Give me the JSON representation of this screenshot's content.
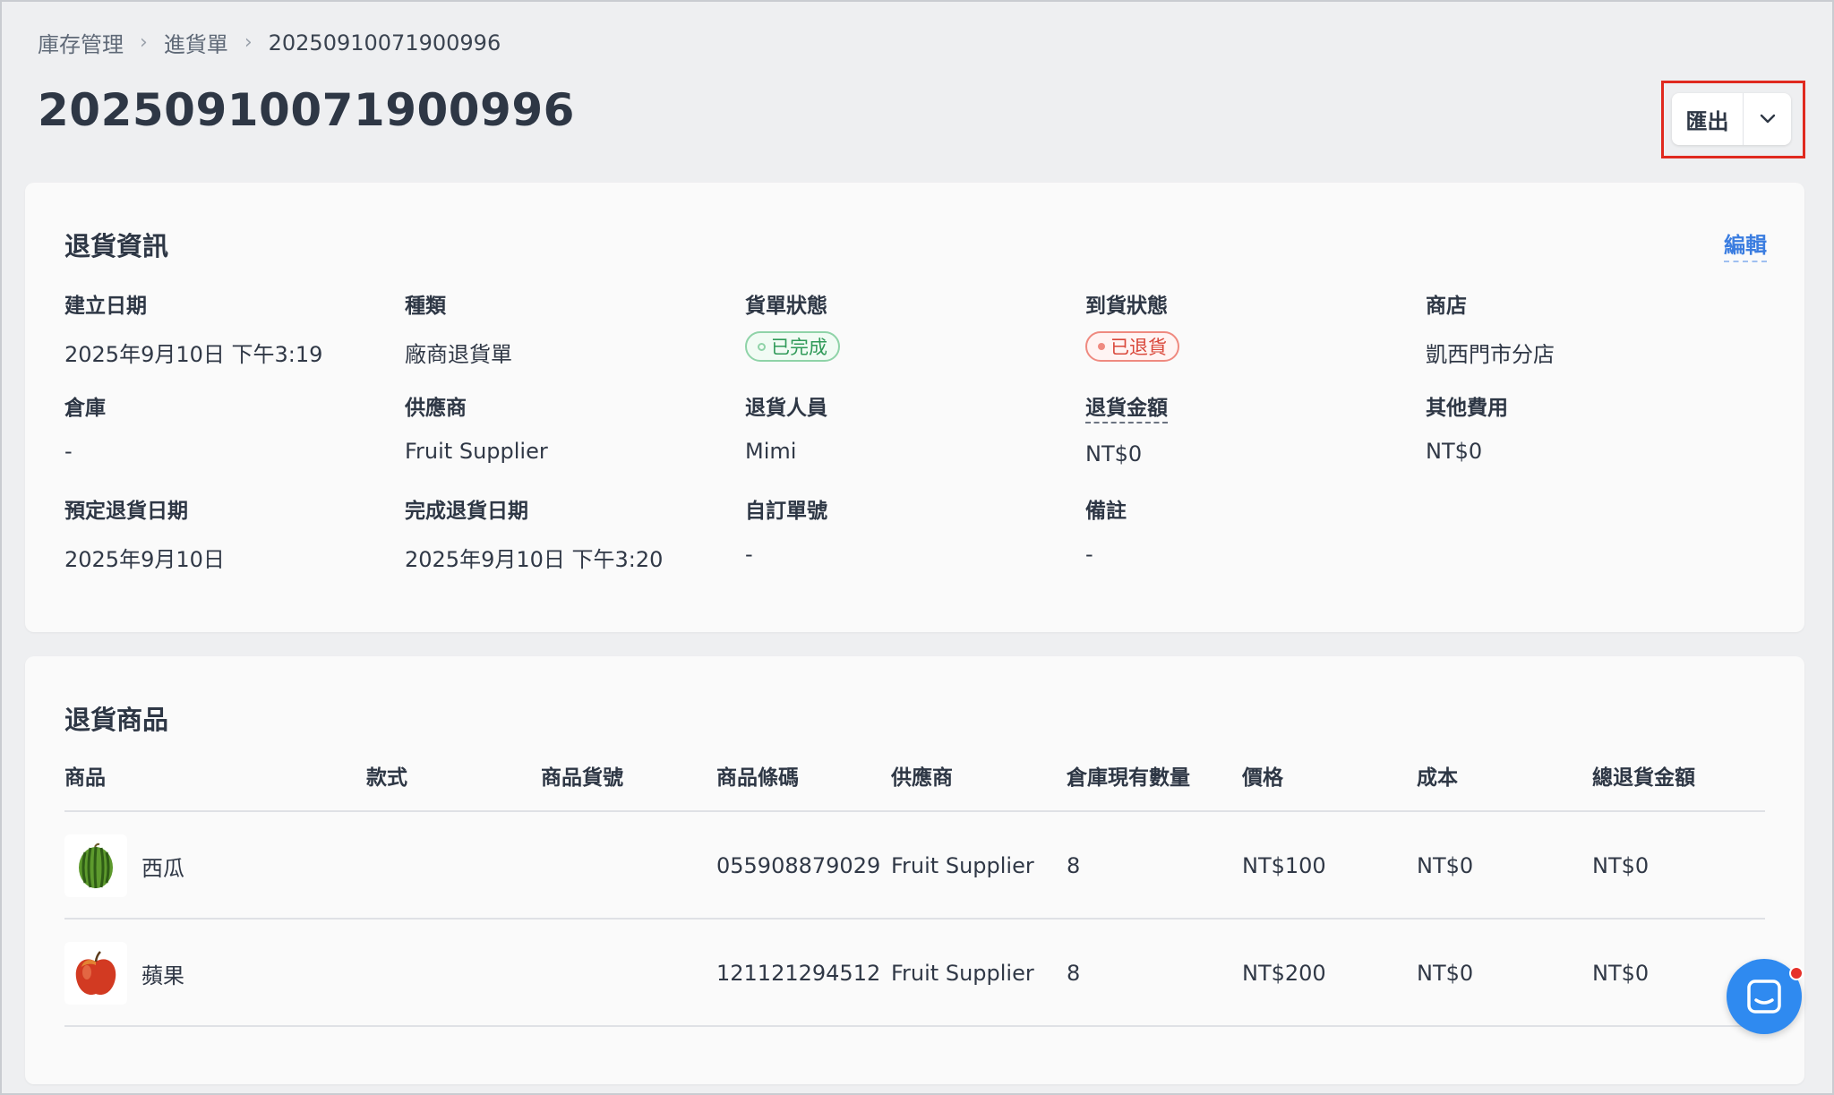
{
  "breadcrumb": {
    "items": [
      "庫存管理",
      "進貨單"
    ],
    "current": "20250910071900996"
  },
  "page_title": "20250910071900996",
  "export": {
    "label": "匯出"
  },
  "info_card": {
    "title": "退貨資訊",
    "edit_label": "編輯",
    "fields": {
      "created_date": {
        "label": "建立日期",
        "value": "2025年9月10日 下午3:19"
      },
      "type": {
        "label": "種類",
        "value": "廠商退貨單"
      },
      "order_status": {
        "label": "貨單狀態",
        "value": "已完成",
        "color": "#2f9a58"
      },
      "arrival_status": {
        "label": "到貨狀態",
        "value": "已退貨",
        "color": "#d9473a"
      },
      "store": {
        "label": "商店",
        "value": "凱西門市分店"
      },
      "warehouse": {
        "label": "倉庫",
        "value": "-"
      },
      "supplier": {
        "label": "供應商",
        "value": "Fruit Supplier"
      },
      "return_staff": {
        "label": "退貨人員",
        "value": "Mimi"
      },
      "return_amount": {
        "label": "退貨金額",
        "value": "NT$0"
      },
      "other_fees": {
        "label": "其他費用",
        "value": "NT$0"
      },
      "scheduled_return_date": {
        "label": "預定退貨日期",
        "value": "2025年9月10日"
      },
      "completed_return_date": {
        "label": "完成退貨日期",
        "value": "2025年9月10日 下午3:20"
      },
      "custom_order_no": {
        "label": "自訂單號",
        "value": "-"
      },
      "notes": {
        "label": "備註",
        "value": "-"
      }
    }
  },
  "items_card": {
    "title": "退貨商品",
    "columns": [
      "商品",
      "款式",
      "商品貨號",
      "商品條碼",
      "供應商",
      "倉庫現有數量",
      "價格",
      "成本",
      "總退貨金額"
    ],
    "rows": [
      {
        "icon": "watermelon-icon",
        "product": "西瓜",
        "variant": "",
        "sku": "",
        "barcode": "055908879029",
        "supplier": "Fruit Supplier",
        "stock": "8",
        "price": "NT$100",
        "cost": "NT$0",
        "total": "NT$0"
      },
      {
        "icon": "apple-icon",
        "product": "蘋果",
        "variant": "",
        "sku": "",
        "barcode": "121121294512",
        "supplier": "Fruit Supplier",
        "stock": "8",
        "price": "NT$200",
        "cost": "NT$0",
        "total": "NT$0"
      }
    ]
  },
  "colors": {
    "accent": "#3b7de0",
    "highlight": "#e02a1f",
    "chat": "#2f8af0"
  }
}
